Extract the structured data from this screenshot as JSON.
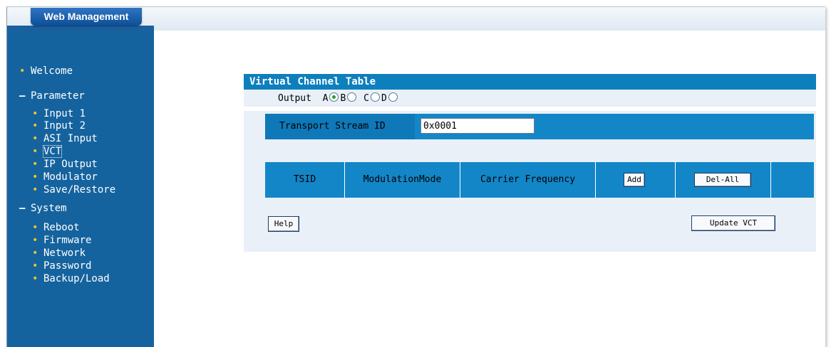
{
  "header": {
    "brand": "Web Management"
  },
  "sidebar": {
    "welcome": "Welcome",
    "parameter": {
      "label": "Parameter",
      "items": [
        "Input 1",
        "Input 2",
        "ASI Input",
        "VCT",
        "IP Output",
        "Modulator",
        "Save/Restore"
      ]
    },
    "system": {
      "label": "System",
      "items": [
        "Reboot",
        "Firmware",
        "Network",
        "Password",
        "Backup/Load"
      ]
    },
    "selected_item": "VCT"
  },
  "vct": {
    "title": "Virtual Channel Table",
    "output_label": "Output",
    "outputs": [
      "A",
      "B",
      "C",
      "D"
    ],
    "selected_output": "A",
    "ts_label": "Transport Stream ID",
    "ts_value": "0x0001",
    "columns": [
      "TSID",
      "ModulationMode",
      "Carrier Frequency"
    ],
    "add_label": "Add",
    "del_all_label": "Del-All",
    "help_label": "Help",
    "update_label": "Update VCT"
  },
  "colors": {
    "sidebar": "#15639e",
    "title_bar": "#0e7fbd",
    "table_bar": "#1386c8",
    "bullet": "#f0c52a",
    "panel_bg": "#e9f0f7"
  }
}
